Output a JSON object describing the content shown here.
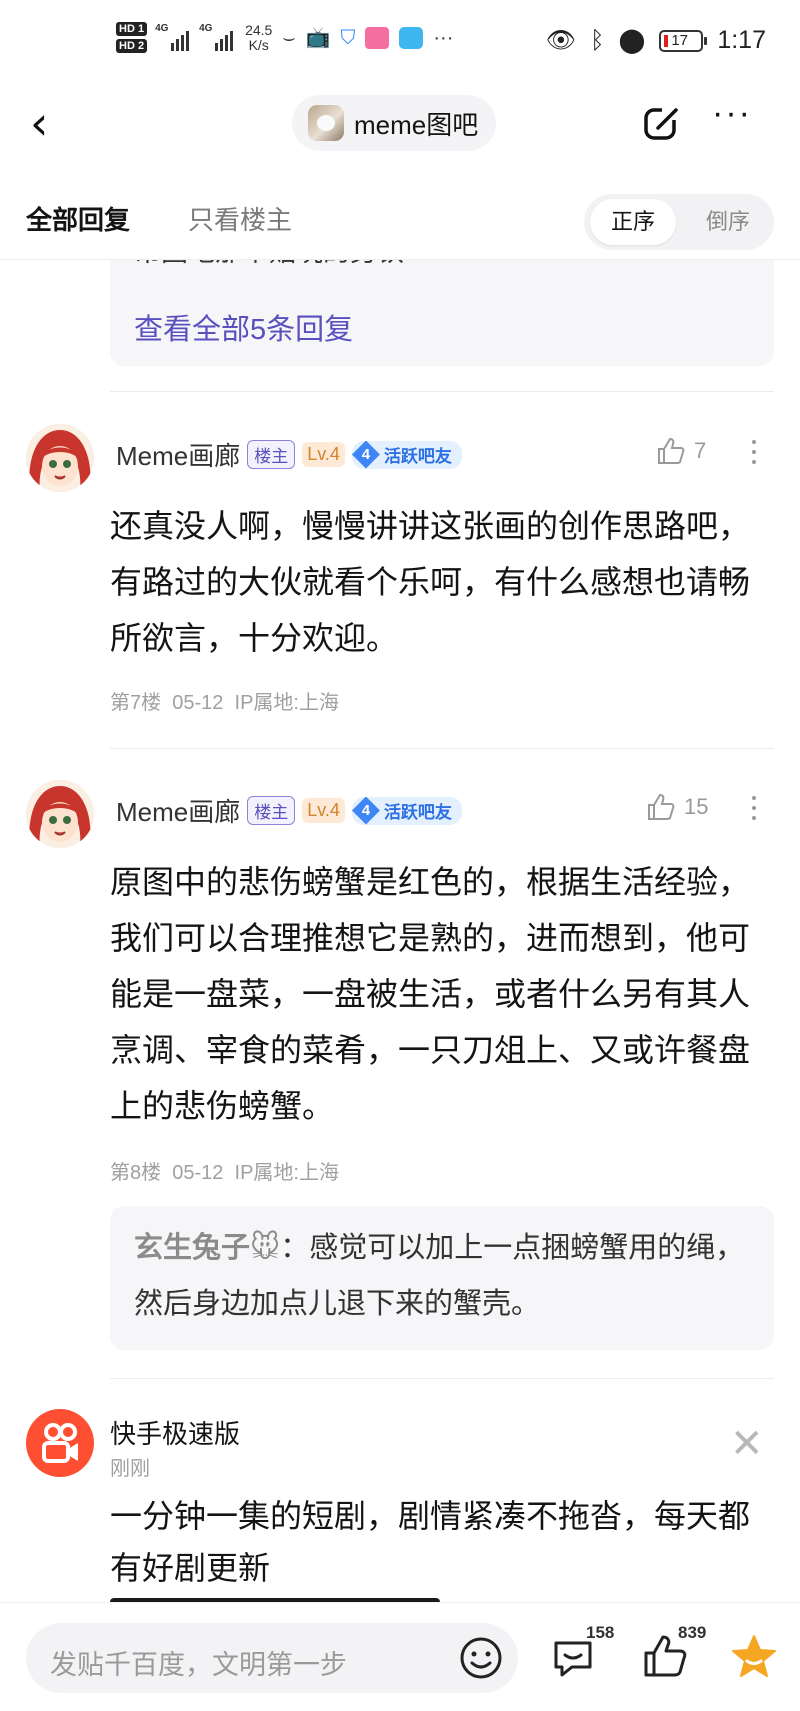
{
  "status_bar": {
    "sim1": "HD 1",
    "sim2": "HD 2",
    "net1": "4G",
    "net2": "4G",
    "speed_value": "24.5",
    "speed_unit": "K/s",
    "battery": "17",
    "time": "1:17"
  },
  "header": {
    "forum_name": "meme图吧"
  },
  "tabs": {
    "all_replies": "全部回复",
    "owner_only": "只看楼主",
    "sort_asc": "正序",
    "sort_desc": "倒序"
  },
  "prev_subreplies": {
    "clipped_text": "吊图吧那个贴玩的劳铁",
    "view_all": "查看全部5条回复"
  },
  "posts": [
    {
      "author": "Meme画廊",
      "owner_badge": "楼主",
      "level": "Lv.4",
      "active_level": "4",
      "active_label": "活跃吧友",
      "likes": "7",
      "text": "还真没人啊，慢慢讲讲这张画的创作思路吧，有路过的大伙就看个乐呵，有什么感想也请畅所欲言，十分欢迎。",
      "floor": "第7楼",
      "date": "05-12",
      "ip": "IP属地:上海"
    },
    {
      "author": "Meme画廊",
      "owner_badge": "楼主",
      "level": "Lv.4",
      "active_level": "4",
      "active_label": "活跃吧友",
      "likes": "15",
      "text": "原图中的悲伤螃蟹是红色的，根据生活经验，我们可以合理推想它是熟的，进而想到，他可能是一盘菜，一盘被生活，或者什么另有其人烹调、宰食的菜肴，一只刀俎上、又或许餐盘上的悲伤螃蟹。",
      "floor": "第8楼",
      "date": "05-12",
      "ip": "IP属地:上海",
      "sub_reply": {
        "user": "玄生兔子🐭",
        "separator": "：",
        "text": "感觉可以加上一点捆螃蟹用的绳，然后身边加点儿退下来的蟹壳。"
      }
    }
  ],
  "ad": {
    "name": "快手极速版",
    "time": "刚刚",
    "text": "一分钟一集的短剧，剧情紧凑不拖沓，每天都有好剧更新"
  },
  "bottom_bar": {
    "input_placeholder": "发贴千百度，文明第一步",
    "reply_count": "158",
    "like_count": "839"
  },
  "colors": {
    "accent_purple": "#5a4fbf",
    "active_blue": "#3e86f5",
    "level_orange": "#d4832e",
    "star_orange": "#f5a623",
    "ad_logo": "#fe4f33"
  }
}
